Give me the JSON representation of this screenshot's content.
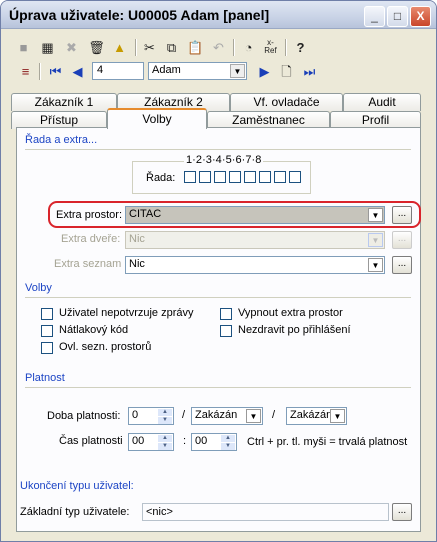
{
  "window": {
    "title": "Úprava uživatele: U00005 Adam [panel]",
    "min_label": "_",
    "max_label": "□",
    "close_label": "X"
  },
  "nav": {
    "record_input": "4",
    "user_select": "Adam"
  },
  "tabs_back": [
    "Zákazník 1",
    "Zákazník 2",
    "Vf. ovladače",
    "Audit"
  ],
  "tabs_front": [
    "Přístup",
    "Volby",
    "Zaměstnanec",
    "Profil"
  ],
  "rada": {
    "header": "Řada a extra...",
    "numbers": "1 · 2 · 3 · 4 · 5 · 6 · 7 · 8",
    "label": "Řada:"
  },
  "extra": {
    "prostor_label": "Extra prostor:",
    "prostor_value": "CITAC",
    "dvere_label": "Extra dveře:",
    "dvere_value": "Nic",
    "seznam_label": "Extra seznam",
    "seznam_value": "Nic",
    "ellipsis": "..."
  },
  "volby": {
    "header": "Volby",
    "left": [
      "Uživatel nepotvrzuje zprávy",
      "Nátlakový kód",
      "Ovl. sezn. prostorů"
    ],
    "right": [
      "Vypnout extra prostor",
      "Nezdravit po přihlášení"
    ]
  },
  "platnost": {
    "header": "Platnost",
    "doba_label": "Doba platnosti:",
    "doba_value": "0",
    "slash": "/",
    "doba_sel1": "Zakázán",
    "doba_sel2": "Zakázán",
    "cas_label": "Čas platnosti",
    "cas_h": "00",
    "colon": ":",
    "cas_m": "00",
    "hint": "Ctrl + pr. tl. myši = trvalá platnost"
  },
  "ukonceni": {
    "header": "Ukončení typu uživatel:",
    "label": "Základní typ uživatele:",
    "value": "<nic>"
  },
  "colors": {
    "accent": "#1d45c5",
    "highlight": "#d9242b"
  }
}
